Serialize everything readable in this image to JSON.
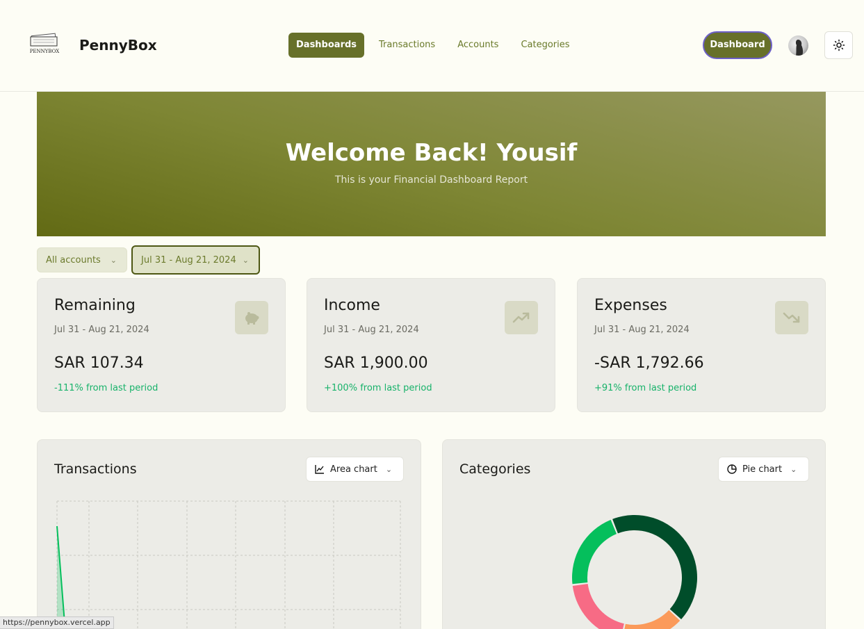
{
  "header": {
    "logo_text": "PENNYBOX",
    "brand": "PennyBox",
    "nav": [
      {
        "label": "Dashboards",
        "active": true
      },
      {
        "label": "Transactions",
        "active": false
      },
      {
        "label": "Accounts",
        "active": false
      },
      {
        "label": "Categories",
        "active": false
      }
    ],
    "cta_label": "Dashboard",
    "theme_icon": "sun-icon"
  },
  "hero": {
    "title": "Welcome Back! Yousif",
    "subtitle": "This is your Financial Dashboard Report"
  },
  "filters": {
    "account": "All accounts",
    "date_range": "Jul 31 - Aug 21, 2024"
  },
  "cards": [
    {
      "title": "Remaining",
      "range": "Jul 31 - Aug 21, 2024",
      "value": "SAR 107.34",
      "change": "-111% from last period",
      "icon": "piggy-bank-icon"
    },
    {
      "title": "Income",
      "range": "Jul 31 - Aug 21, 2024",
      "value": "SAR 1,900.00",
      "change": "+100% from last period",
      "icon": "trending-up-icon"
    },
    {
      "title": "Expenses",
      "range": "Jul 31 - Aug 21, 2024",
      "value": "-SAR 1,792.66",
      "change": "+91% from last period",
      "icon": "trending-down-icon"
    }
  ],
  "transactions_panel": {
    "title": "Transactions",
    "chart_type_label": "Area chart"
  },
  "categories_panel": {
    "title": "Categories",
    "chart_type_label": "Pie chart"
  },
  "colors": {
    "accent": "#67702a",
    "positive": "#17b26a",
    "donut": [
      "#004d2a",
      "#fb9a5a",
      "#f76b85",
      "#05bf5c"
    ]
  },
  "chart_data": [
    {
      "type": "area",
      "title": "Transactions",
      "grid": true,
      "series": [
        {
          "values": [
            1900,
            0
          ]
        }
      ]
    },
    {
      "type": "pie",
      "title": "Categories",
      "values": [
        0.39,
        0.15,
        0.18,
        0.19
      ]
    }
  ],
  "status_url": "https://pennybox.vercel.app"
}
